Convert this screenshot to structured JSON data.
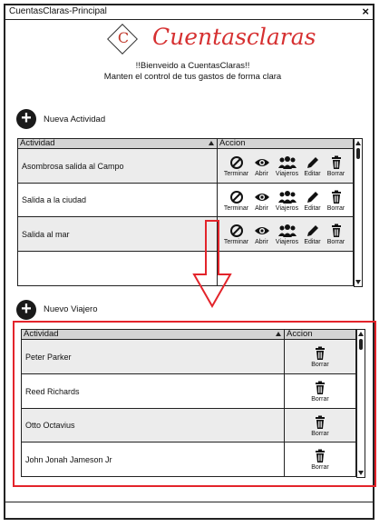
{
  "window": {
    "title": "CuentasClaras-Principal",
    "close_glyph": "×"
  },
  "logo": {
    "letter": "C",
    "brand": "Cuentasclaras",
    "brand_color": "#d63031"
  },
  "welcome": {
    "line1": "!!Bienveido a CuentasClaras!!",
    "line2": "Manten el control de tus gastos de forma clara"
  },
  "actividades": {
    "add_label": "Nueva Actividad",
    "columns": {
      "name": "Actividad",
      "actions": "Accion"
    },
    "action_labels": {
      "finish": "Terminar",
      "open": "Abrir",
      "travelers": "Viajeros",
      "edit": "Editar",
      "delete": "Borrar"
    },
    "rows": [
      {
        "name": "Asombrosa salida al Campo"
      },
      {
        "name": "Salida a la ciudad"
      },
      {
        "name": "Salida al mar"
      }
    ]
  },
  "viajeros": {
    "add_label": "Nuevo Viajero",
    "columns": {
      "name": "Actividad",
      "actions": "Accion"
    },
    "delete_label": "Borrar",
    "rows": [
      {
        "name": "Peter Parker"
      },
      {
        "name": "Reed Richards"
      },
      {
        "name": "Otto Octavius"
      },
      {
        "name": "John Jonah Jameson Jr"
      }
    ]
  },
  "annotation": {
    "highlight_color": "#e3242b",
    "arrow": "down"
  }
}
